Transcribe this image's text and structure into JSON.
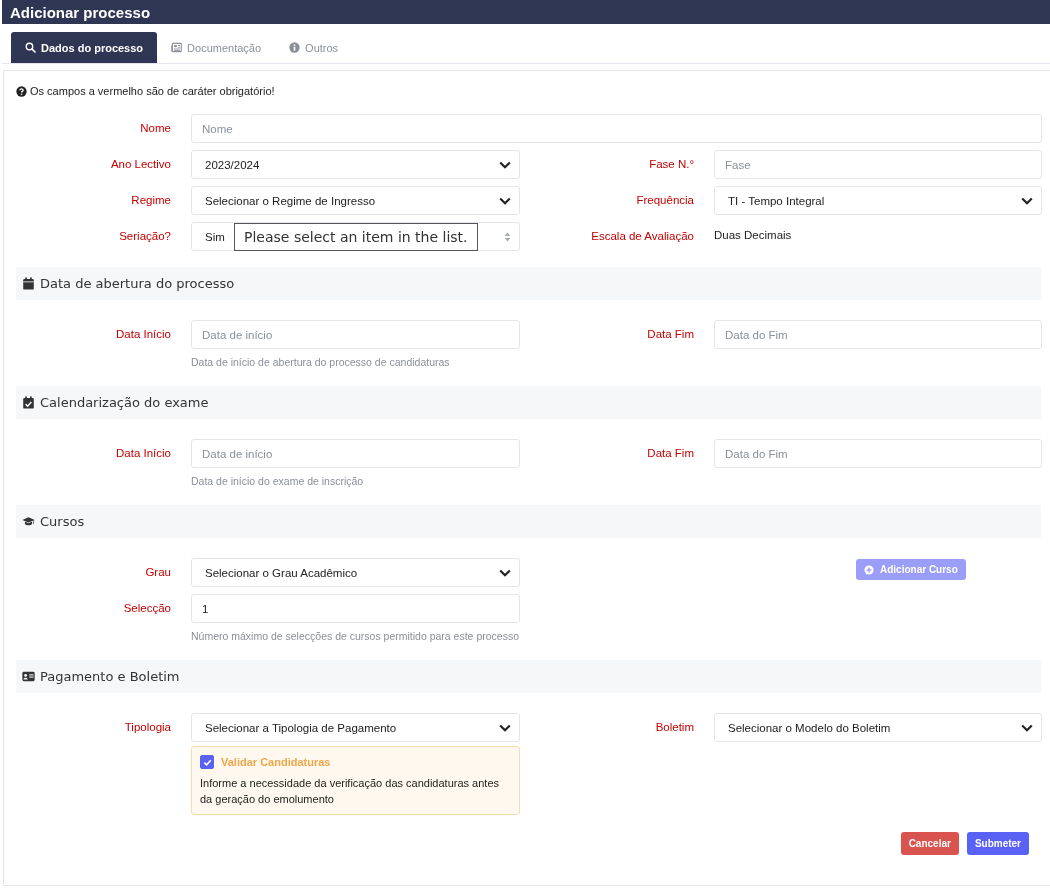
{
  "window": {
    "title": "Adicionar processo"
  },
  "tabs": [
    {
      "label": "Dados do processo",
      "selected": true
    },
    {
      "label": "Documentação",
      "selected": false
    },
    {
      "label": "Outros",
      "selected": false
    }
  ],
  "notice": "Os campos a vermelho são de caráter obrigatório!",
  "sections": [
    {
      "rows": [
        {
          "left": {
            "kind": "wide-text",
            "label": "Nome",
            "placeholder": "Nome"
          }
        },
        {
          "left": {
            "kind": "select",
            "label": "Ano Lectivo",
            "value": "2023/2024"
          },
          "right": {
            "kind": "text",
            "label": "Fase N.°",
            "placeholder": "Fase"
          }
        },
        {
          "left": {
            "kind": "select",
            "label": "Regime",
            "value": "Selecionar o Regime de Ingresso"
          },
          "right": {
            "kind": "select",
            "label": "Frequência",
            "value": "TI - Tempo Integral"
          }
        },
        {
          "left": {
            "kind": "spinner",
            "label": "Seriação?",
            "value": "Sim",
            "tooltip": "Please select an item in the list."
          },
          "right": {
            "kind": "static",
            "label": "Escala de Avaliação",
            "value": "Duas Decimais"
          }
        }
      ]
    },
    {
      "title": "Data de abertura do processo",
      "rows": [
        {
          "left": {
            "kind": "text",
            "label": "Data Início",
            "placeholder": "Data de início",
            "help": "Data de início de abertura do processo de candidaturas"
          },
          "right": {
            "kind": "text",
            "label": "Data Fim",
            "placeholder": "Data do Fim"
          }
        }
      ]
    },
    {
      "title": "Calendarização do exame",
      "rows": [
        {
          "left": {
            "kind": "text",
            "label": "Data Início",
            "placeholder": "Data de início",
            "help": "Data de início do exame de inscrição"
          },
          "right": {
            "kind": "text",
            "label": "Data Fim",
            "placeholder": "Data do Fim"
          }
        }
      ]
    },
    {
      "title": "Cursos",
      "rows": [
        {
          "left": {
            "kind": "select",
            "label": "Grau",
            "value": "Selecionar o Grau Acadêmico"
          },
          "right": {
            "kind": "button",
            "label": "Adicionar Curso",
            "disabled": true
          }
        },
        {
          "left": {
            "kind": "text",
            "label": "Selecção",
            "value": "1",
            "help": "Número máximo de selecções de cursos permitido para este processo"
          }
        }
      ]
    },
    {
      "title": "Pagamento e Boletim",
      "rows": [
        {
          "left": {
            "kind": "select",
            "label": "Tipologia",
            "value": "Selecionar a Tipologia de Pagamento",
            "note": {
              "label": "Validar Candidaturas",
              "checked": true,
              "text": "Informe a necessidade da verificação das candidaturas antes da geração do emolumento"
            }
          },
          "right": {
            "kind": "select",
            "label": "Boletim",
            "value": "Selecionar o Modelo do Boletim"
          }
        }
      ]
    }
  ],
  "buttons": [
    {
      "label": "Cancelar",
      "kind": "danger"
    },
    {
      "label": "Submeter",
      "kind": "primary"
    }
  ]
}
